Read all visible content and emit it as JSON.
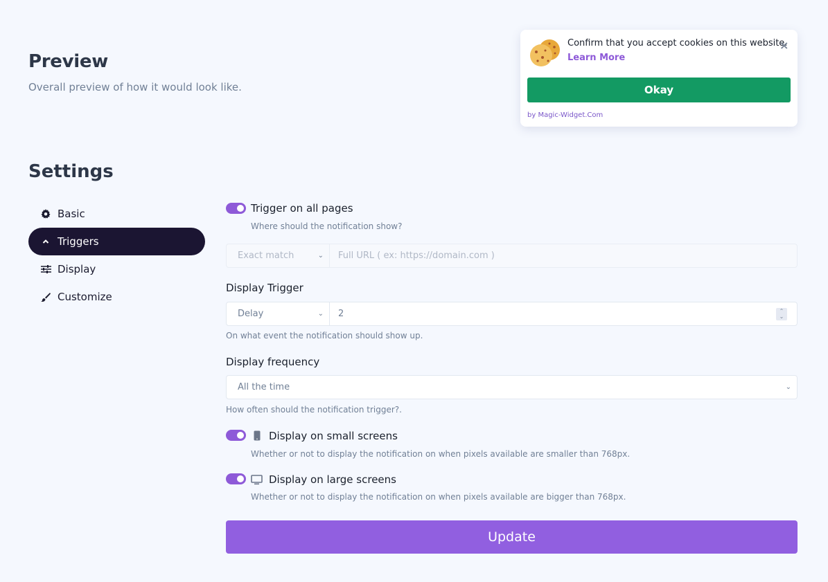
{
  "preview": {
    "title": "Preview",
    "subtitle": "Overall preview of how it would look like."
  },
  "cookie_widget": {
    "message": "Confirm that you accept cookies on this website.",
    "learn_more": "Learn More",
    "close_glyph": "×",
    "okay_label": "Okay",
    "branding": "by Magic-Widget.Com",
    "button_color": "#139a63",
    "link_color": "#8e5ad8"
  },
  "settings": {
    "title": "Settings",
    "nav": [
      {
        "label": "Basic",
        "icon": "gear-icon",
        "active": false
      },
      {
        "label": "Triggers",
        "icon": "chevron-up-icon",
        "active": true
      },
      {
        "label": "Display",
        "icon": "sliders-icon",
        "active": false
      },
      {
        "label": "Customize",
        "icon": "paintbrush-icon",
        "active": false
      }
    ]
  },
  "form": {
    "trigger_all_pages": {
      "label": "Trigger on all pages",
      "help": "Where should the notification show?",
      "enabled": true
    },
    "url_match": {
      "select_value": "Exact match",
      "placeholder": "Full URL ( ex: https://domain.com )"
    },
    "display_trigger": {
      "label": "Display Trigger",
      "select_value": "Delay",
      "value": "2",
      "help": "On what event the notification should show up."
    },
    "display_frequency": {
      "label": "Display frequency",
      "select_value": "All the time",
      "help": "How often should the notification trigger?."
    },
    "small_screens": {
      "label": "Display on small screens",
      "help": "Whether or not to display the notification on when pixels available are smaller than 768px.",
      "enabled": true
    },
    "large_screens": {
      "label": "Display on large screens",
      "help": "Whether or not to display the notification on when pixels available are bigger than 768px.",
      "enabled": true
    },
    "update_label": "Update",
    "accent_color": "#915fe0"
  }
}
